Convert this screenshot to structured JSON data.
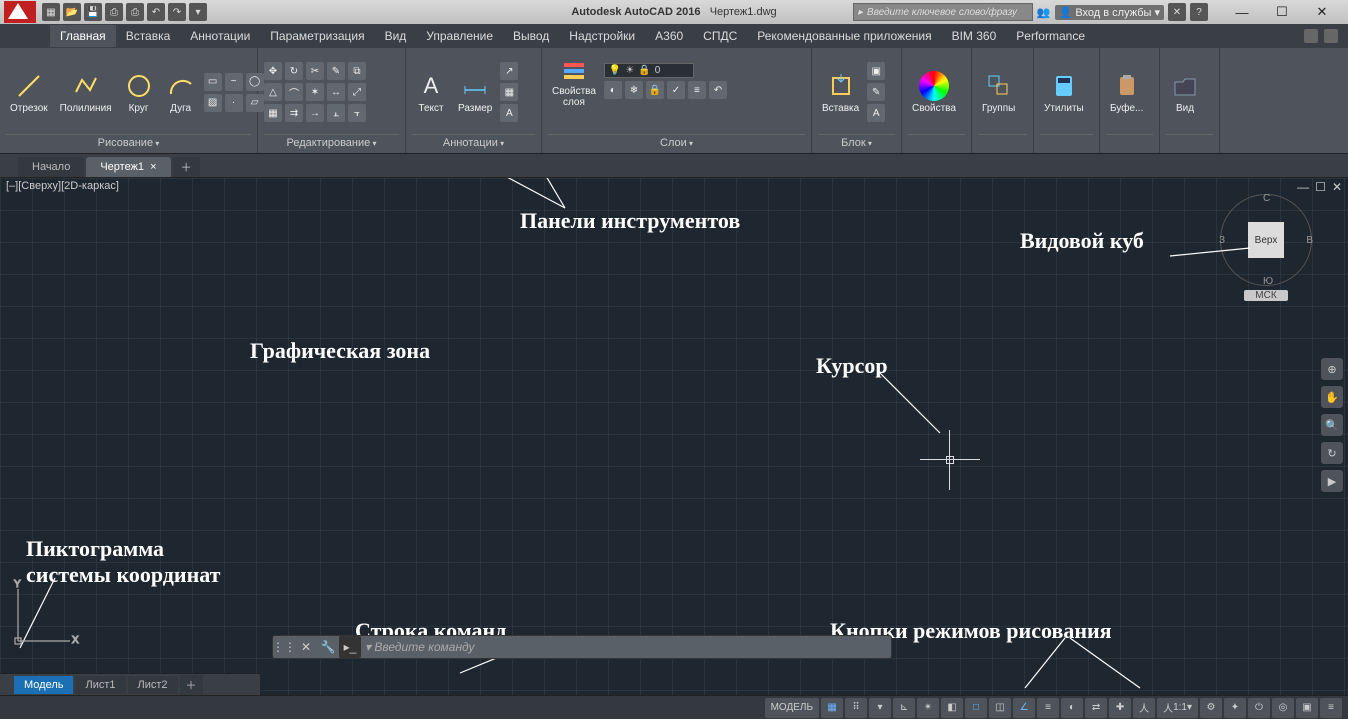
{
  "title": {
    "app": "Autodesk AutoCAD 2016",
    "file": "Чертеж1.dwg"
  },
  "search_placeholder": "Введите ключевое слово/фразу",
  "signin_label": "Вход в службы",
  "ribbon_tabs": [
    "Главная",
    "Вставка",
    "Аннотации",
    "Параметризация",
    "Вид",
    "Управление",
    "Вывод",
    "Надстройки",
    "A360",
    "СПДС",
    "Рекомендованные приложения",
    "BIM 360",
    "Performance"
  ],
  "draw": {
    "line": "Отрезок",
    "polyline": "Полилиния",
    "circle": "Круг",
    "arc": "Дуга",
    "panel": "Рисование"
  },
  "modify": {
    "panel": "Редактирование"
  },
  "annot": {
    "text": "Текст",
    "dim": "Размер",
    "panel": "Аннотации"
  },
  "layers": {
    "props": "Свойства\nслоя",
    "panel": "Слои",
    "current": "0"
  },
  "block": {
    "insert": "Вставка",
    "panel": "Блок"
  },
  "props": {
    "btn": "Свойства",
    "panel": ""
  },
  "groups": {
    "btn": "Группы",
    "panel": ""
  },
  "utils": {
    "btn": "Утилиты",
    "panel": ""
  },
  "clip": {
    "btn": "Буфе...",
    "panel": ""
  },
  "view": {
    "btn": "Вид",
    "panel": ""
  },
  "file_tabs": {
    "start": "Начало",
    "active": "Чертеж1"
  },
  "viewport_label": "[–][Сверху][2D-каркас]",
  "viewcube": {
    "face": "Верх",
    "n": "С",
    "s": "Ю",
    "e": "В",
    "w": "З",
    "wcs": "МСК"
  },
  "cmd_prompt": "Введите команду",
  "layout_tabs": {
    "model": "Модель",
    "sheet1": "Лист1",
    "sheet2": "Лист2"
  },
  "status": {
    "model": "МОДЕЛЬ",
    "scale": "1:1"
  },
  "annotations": {
    "toolbars": "Панели инструментов",
    "viewcube": "Видовой куб",
    "graphics": "Графическая зона",
    "cursor": "Курсор",
    "ucs1": "Пиктограмма",
    "ucs2": "системы координат",
    "cmdline": "Строка команд",
    "drawmodes": "Кнопки режимов рисования"
  }
}
